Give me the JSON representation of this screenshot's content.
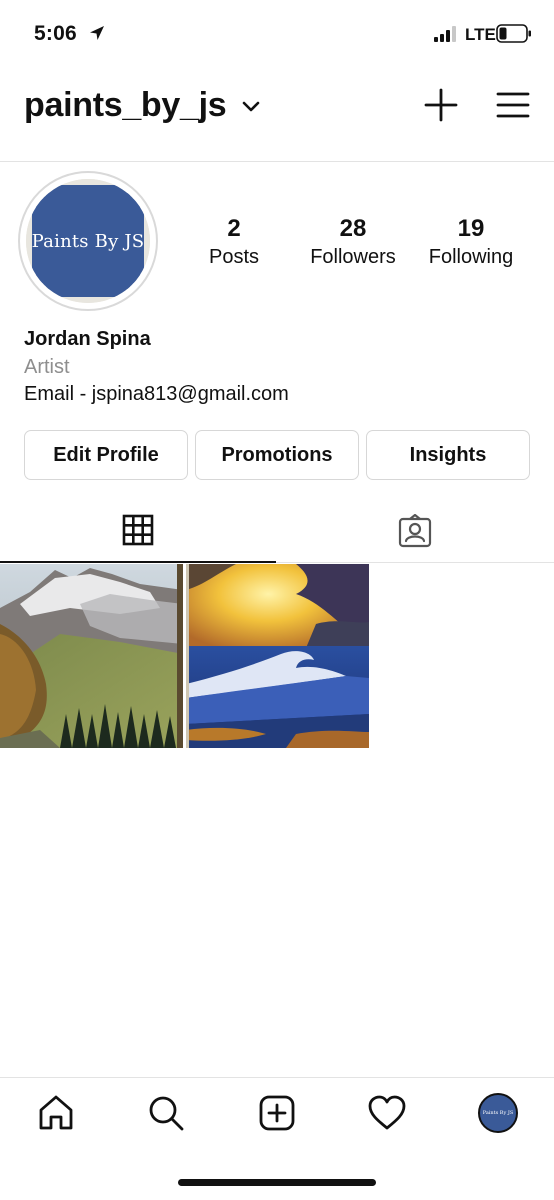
{
  "status_bar": {
    "time": "5:06",
    "network": "LTE",
    "icons": [
      "location-arrow-icon",
      "signal-icon",
      "battery-icon"
    ]
  },
  "header": {
    "username": "paints_by_js",
    "icons": [
      "chevron-down-icon",
      "plus-icon",
      "menu-icon"
    ]
  },
  "profile": {
    "avatar_text": "Paints By JS",
    "stats": {
      "posts": {
        "value": "2",
        "label": "Posts"
      },
      "followers": {
        "value": "28",
        "label": "Followers"
      },
      "following": {
        "value": "19",
        "label": "Following"
      }
    },
    "full_name": "Jordan Spina",
    "category": "Artist",
    "bio": "Email - jspina813@gmail.com"
  },
  "buttons": {
    "edit_profile": "Edit Profile",
    "promotions": "Promotions",
    "insights": "Insights"
  },
  "tabs": [
    {
      "icon": "grid-icon",
      "selected": true
    },
    {
      "icon": "tagged-icon",
      "selected": false
    }
  ],
  "posts": [
    {
      "subject": "mountain landscape painting"
    },
    {
      "subject": "ocean wave sunset painting"
    }
  ],
  "bottom_nav": {
    "icons": [
      "home-icon",
      "search-icon",
      "add-post-icon",
      "heart-icon",
      "profile-avatar-icon"
    ]
  },
  "colors": {
    "avatar_blue": "#3a5a98",
    "text_primary": "#111111",
    "text_secondary": "#8e8e8e",
    "border": "#d7d7d7"
  }
}
